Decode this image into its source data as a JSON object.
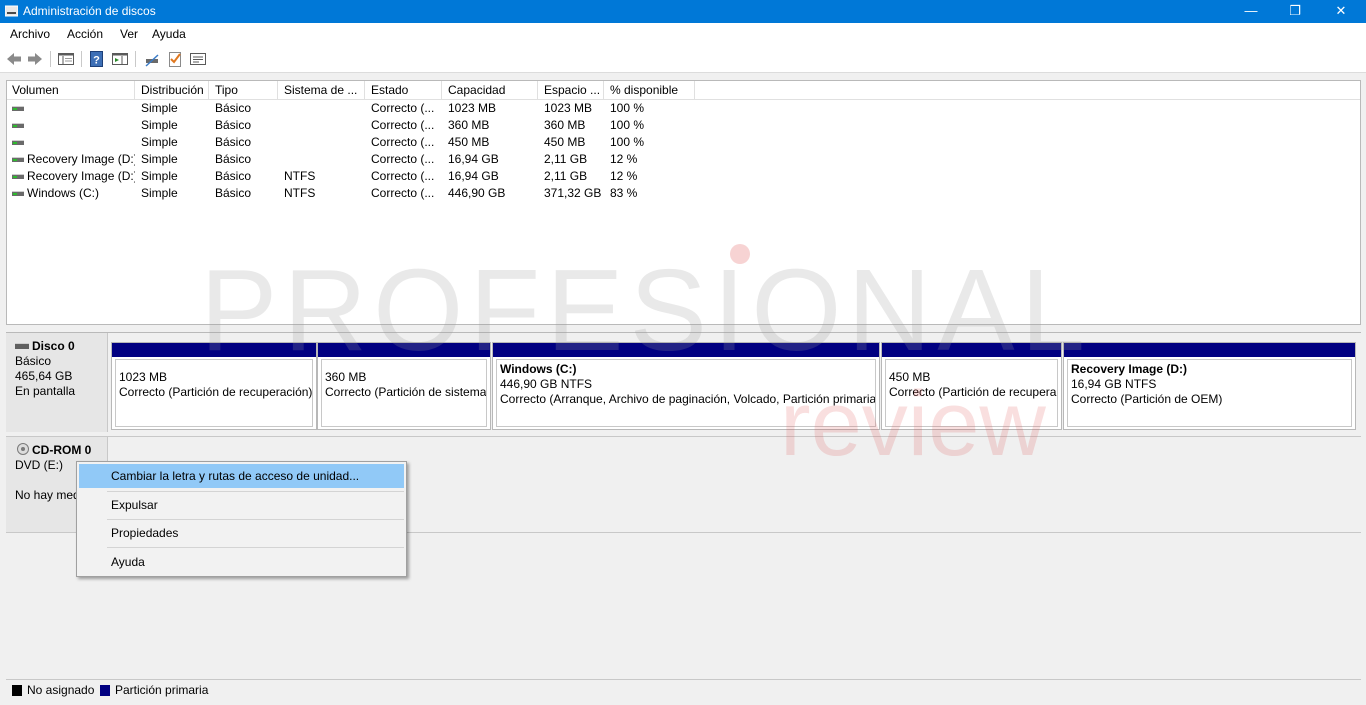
{
  "window": {
    "title": "Administración de discos",
    "controls": {
      "minimize": "—",
      "restore": "❐",
      "close": "✕"
    }
  },
  "menu": [
    "Archivo",
    "Acción",
    "Ver",
    "Ayuda"
  ],
  "toolbar_icons": [
    "back-arrow-icon",
    "forward-arrow-icon",
    "console-tree-icon",
    "help-icon",
    "show-hide-action-pane-icon",
    "connect-drive-icon",
    "checklist-icon",
    "properties-icon"
  ],
  "volume_table": {
    "headers": [
      "Volumen",
      "Distribución",
      "Tipo",
      "Sistema de ...",
      "Estado",
      "Capacidad",
      "Espacio ...",
      "% disponible"
    ],
    "rows": [
      [
        "",
        "Simple",
        "Básico",
        "",
        "Correcto (...",
        "1023 MB",
        "1023 MB",
        "100 %"
      ],
      [
        "",
        "Simple",
        "Básico",
        "",
        "Correcto (...",
        "360 MB",
        "360 MB",
        "100 %"
      ],
      [
        "",
        "Simple",
        "Básico",
        "",
        "Correcto (...",
        "450 MB",
        "450 MB",
        "100 %"
      ],
      [
        "Recovery Image (D:)",
        "Simple",
        "Básico",
        "",
        "Correcto (...",
        "16,94 GB",
        "2,11 GB",
        "12 %"
      ],
      [
        "Recovery Image (D:)",
        "Simple",
        "Básico",
        "NTFS",
        "Correcto (...",
        "16,94 GB",
        "2,11 GB",
        "12 %"
      ],
      [
        "Windows (C:)",
        "Simple",
        "Básico",
        "NTFS",
        "Correcto (...",
        "446,90 GB",
        "371,32 GB",
        "83 %"
      ]
    ]
  },
  "disks": {
    "disk0": {
      "name": "Disco 0",
      "type": "Básico",
      "size": "465,64 GB",
      "status": "En pantalla",
      "partitions": [
        {
          "title": "",
          "line1": "1023 MB",
          "line2": "Correcto (Partición de recuperación)"
        },
        {
          "title": "",
          "line1": "360 MB",
          "line2": "Correcto (Partición de sistema"
        },
        {
          "title": "Windows  (C:)",
          "line1": "446,90 GB NTFS",
          "line2": "Correcto (Arranque, Archivo de paginación, Volcado, Partición primaria"
        },
        {
          "title": "",
          "line1": "450 MB",
          "line2": "Correcto (Partición de recupera"
        },
        {
          "title": "Recovery Image  (D:)",
          "line1": "16,94 GB NTFS",
          "line2": "Correcto (Partición de OEM)"
        }
      ]
    },
    "cdrom0": {
      "name": "CD-ROM 0",
      "drive": "DVD (E:)",
      "status": "No hay medio"
    }
  },
  "context_menu": {
    "items": [
      "Cambiar la letra y rutas de acceso de unidad...",
      "Expulsar",
      "Propiedades",
      "Ayuda"
    ],
    "highlighted_index": 0
  },
  "legend": [
    {
      "label": "No asignado",
      "color": "#000000"
    },
    {
      "label": "Partición primaria",
      "color": "#010081"
    }
  ],
  "watermark": {
    "text1": "PROFESIONAL",
    "text2": "review"
  }
}
